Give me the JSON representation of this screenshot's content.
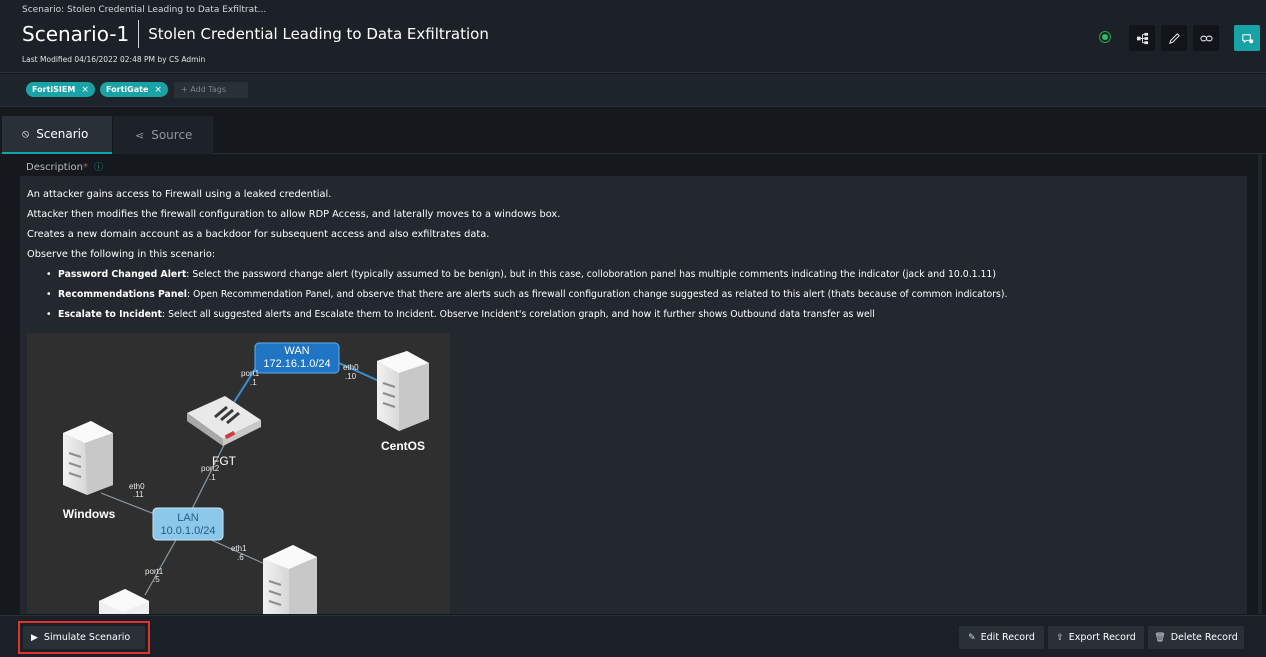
{
  "header": {
    "breadcrumb": "Scenario: Stolen Credential Leading to Data Exfiltrat...",
    "record_id": "Scenario-1",
    "record_name": "Stolen Credential Leading to Data Exfiltration",
    "last_modified": "Last Modified 04/16/2022 02:48 PM by CS Admin",
    "status_color": "#27c25b",
    "buttons": [
      {
        "icon": "hierarchy-icon"
      },
      {
        "icon": "pencil-icon"
      },
      {
        "icon": "link-icon"
      },
      {
        "icon": "chat-icon",
        "color": "#17a2a6"
      }
    ]
  },
  "tags": {
    "items": [
      "FortiSIEM",
      "FortiGate"
    ],
    "remove_symbol": "×",
    "add_placeholder": "+ Add Tags",
    "color": "#1aa3a6"
  },
  "tabs": [
    {
      "label": "Scenario",
      "icon": "scenario-icon",
      "active": true
    },
    {
      "label": "Source",
      "icon": "source-icon",
      "active": false
    }
  ],
  "description": {
    "label": "Description",
    "required_mark": "*",
    "info_symbol": "ⓘ",
    "lines": [
      "An attacker gains access to Firewall using a leaked credential.",
      "Attacker then modifies the firewall configuration to allow RDP Access, and laterally moves to a windows box.",
      "Creates a new domain account as a backdoor for subsequent access and also exfiltrates data.",
      "Observe the following in this scenario:"
    ],
    "bullets": [
      {
        "title": "Password Changed Alert",
        "text": ": Select the password change alert (typically assumed to be benign), but in this case, colloboration panel has multiple comments indicating the indicator (jack and 10.0.1.11)"
      },
      {
        "title": "Recommendations Panel",
        "text": ": Open Recommendation Panel, and observe that there are alerts such as firewall configuration change suggested as related to this alert (thats because of common indicators)."
      },
      {
        "title": "Escalate to Incident",
        "text": ": Select all suggested alerts and Escalate them to Incident. Observe Incident's corelation graph, and how it further shows Outbound data transfer as well"
      }
    ]
  },
  "diagram": {
    "wan": {
      "name": "WAN",
      "subnet": "172.16.1.0/24"
    },
    "lan": {
      "name": "LAN",
      "subnet": "10.0.1.0/24"
    },
    "nodes": {
      "firewall": "FGT",
      "server": "CentOS",
      "workstation": "Windows"
    },
    "ports": {
      "fgt_wan": [
        "port1",
        ".1"
      ],
      "centos": [
        "eth0",
        ".10"
      ],
      "fgt_lan": [
        "port2",
        ".1"
      ],
      "windows": [
        "eth0",
        ".11"
      ],
      "bottom_right": [
        "eth1",
        ".6"
      ],
      "bottom_left": [
        "port1",
        ".5"
      ]
    }
  },
  "footer": {
    "simulate_label": "Simulate Scenario",
    "edit_label": "Edit Record",
    "export_label": "Export Record",
    "delete_label": "Delete Record"
  }
}
